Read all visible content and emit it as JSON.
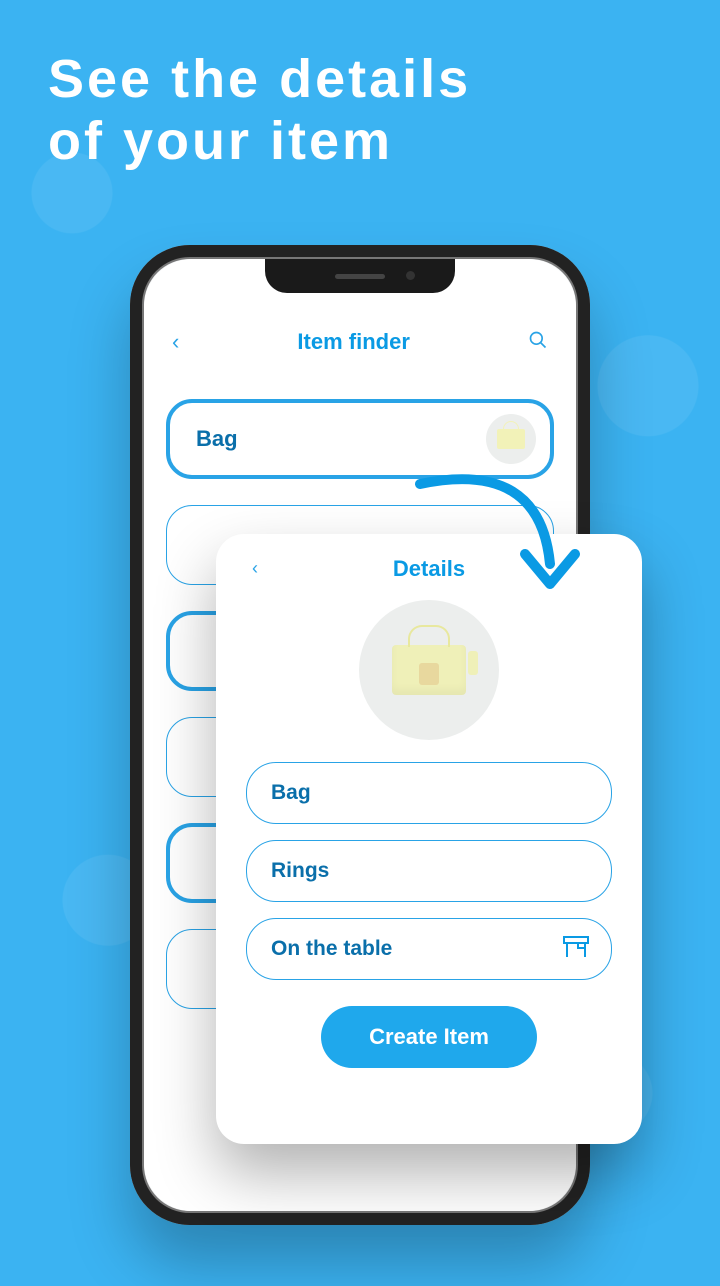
{
  "headline": {
    "line1": "See the details",
    "line2": "of your item"
  },
  "phone": {
    "header": {
      "title": "Item finder"
    },
    "items": [
      {
        "label": "Bag",
        "selected": true,
        "has_thumb": true
      }
    ]
  },
  "details": {
    "title": "Details",
    "fields": [
      {
        "label": "Bag"
      },
      {
        "label": "Rings"
      },
      {
        "label": "On the table",
        "has_icon": true
      }
    ],
    "create_button": "Create Item"
  }
}
